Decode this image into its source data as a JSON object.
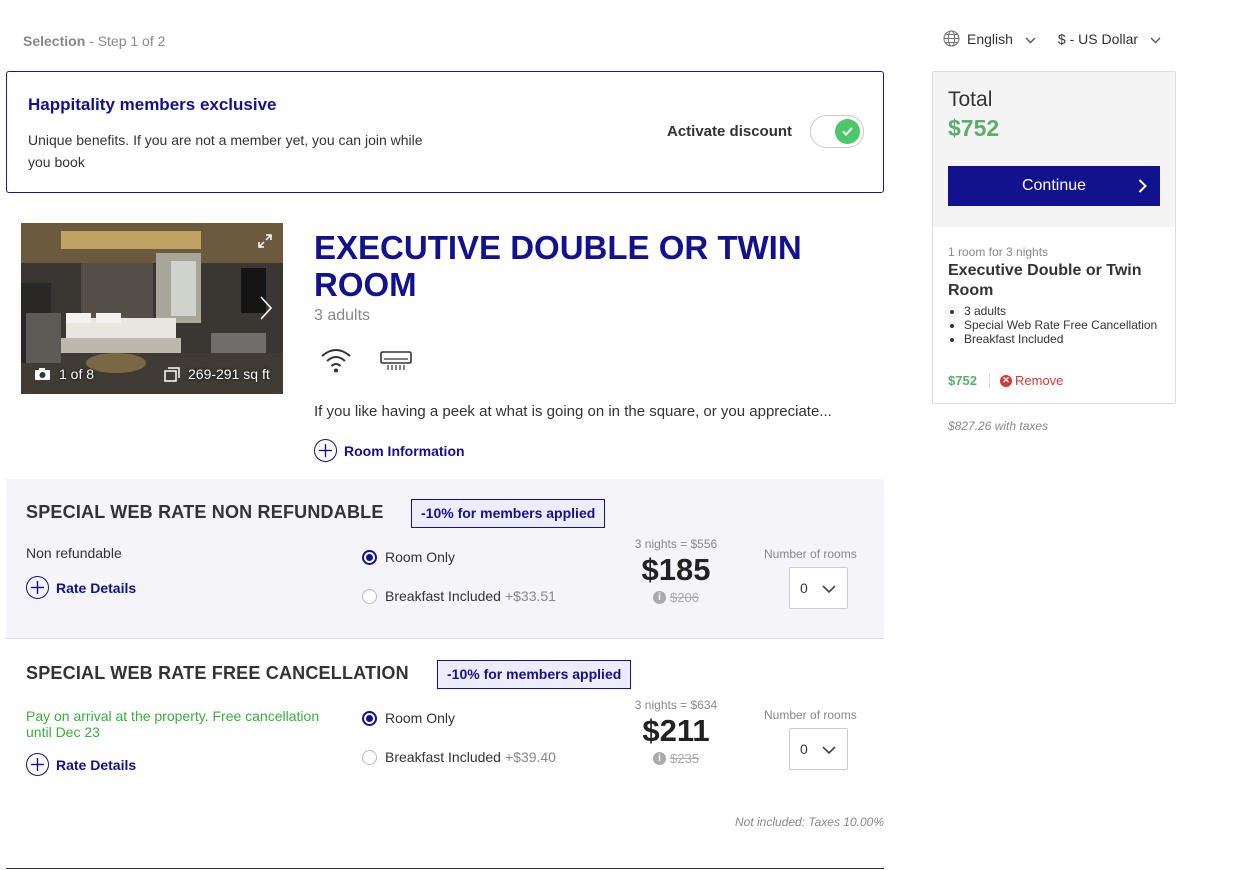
{
  "header": {
    "step_label": "Selection",
    "step_text": " - Step 1 of 2",
    "language": "English",
    "currency": "$ - US Dollar"
  },
  "member_banner": {
    "title": "Happitality members exclusive",
    "text": "Unique benefits. If you are not a member yet, you can join while you book",
    "activate_label": "Activate discount",
    "toggle_on": true
  },
  "room": {
    "photo_count": "1 of 8",
    "size": "269-291 sq ft",
    "title": "EXECUTIVE DOUBLE OR TWIN ROOM",
    "occupancy": "3 adults",
    "amenities": [
      "wifi-icon",
      "air-conditioning-icon"
    ],
    "description": "If you like having a peek at what is going on in the square, or you appreciate...",
    "info_link": "Room Information"
  },
  "rates": [
    {
      "title": "SPECIAL WEB RATE NON REFUNDABLE",
      "badge": "-10% for members applied",
      "condition": "Non refundable",
      "details_link": "Rate Details",
      "option_1": "Room Only",
      "option_2": "Breakfast Included",
      "option_2_addon": "+$33.51",
      "selected_option": "Room Only",
      "nights_total": "3 nights = $556",
      "price": "$185",
      "old_price": "$206",
      "rooms_label": "Number of rooms",
      "rooms_value": "0"
    },
    {
      "title": "SPECIAL WEB RATE FREE CANCELLATION",
      "badge": "-10% for members applied",
      "condition": "Pay on arrival at the property. Free cancellation until Dec 23",
      "details_link": "Rate Details",
      "option_1": "Room Only",
      "option_2": "Breakfast Included",
      "option_2_addon": "+$39.40",
      "selected_option": "Room Only",
      "nights_total": "3 nights = $634",
      "price": "$211",
      "old_price": "$235",
      "rooms_label": "Number of rooms",
      "rooms_value": "0"
    }
  ],
  "footer_note": "Not included: Taxes 10.00%",
  "summary": {
    "total_label": "Total",
    "total_value": "$752",
    "continue_label": "Continue",
    "nights": "1 room for 3 nights",
    "room_name": "Executive Double or Twin Room",
    "items": [
      "3 adults",
      "Special Web Rate Free Cancellation",
      "Breakfast Included"
    ],
    "price": "$752",
    "remove_label": "Remove",
    "with_taxes": "$827.26 with taxes"
  },
  "colors": {
    "brand": "#12118e",
    "price_green": "#5aad6c",
    "condition_green": "#3aad3f",
    "remove_red": "#d43a3a",
    "toggle_green": "#4cc76b"
  }
}
